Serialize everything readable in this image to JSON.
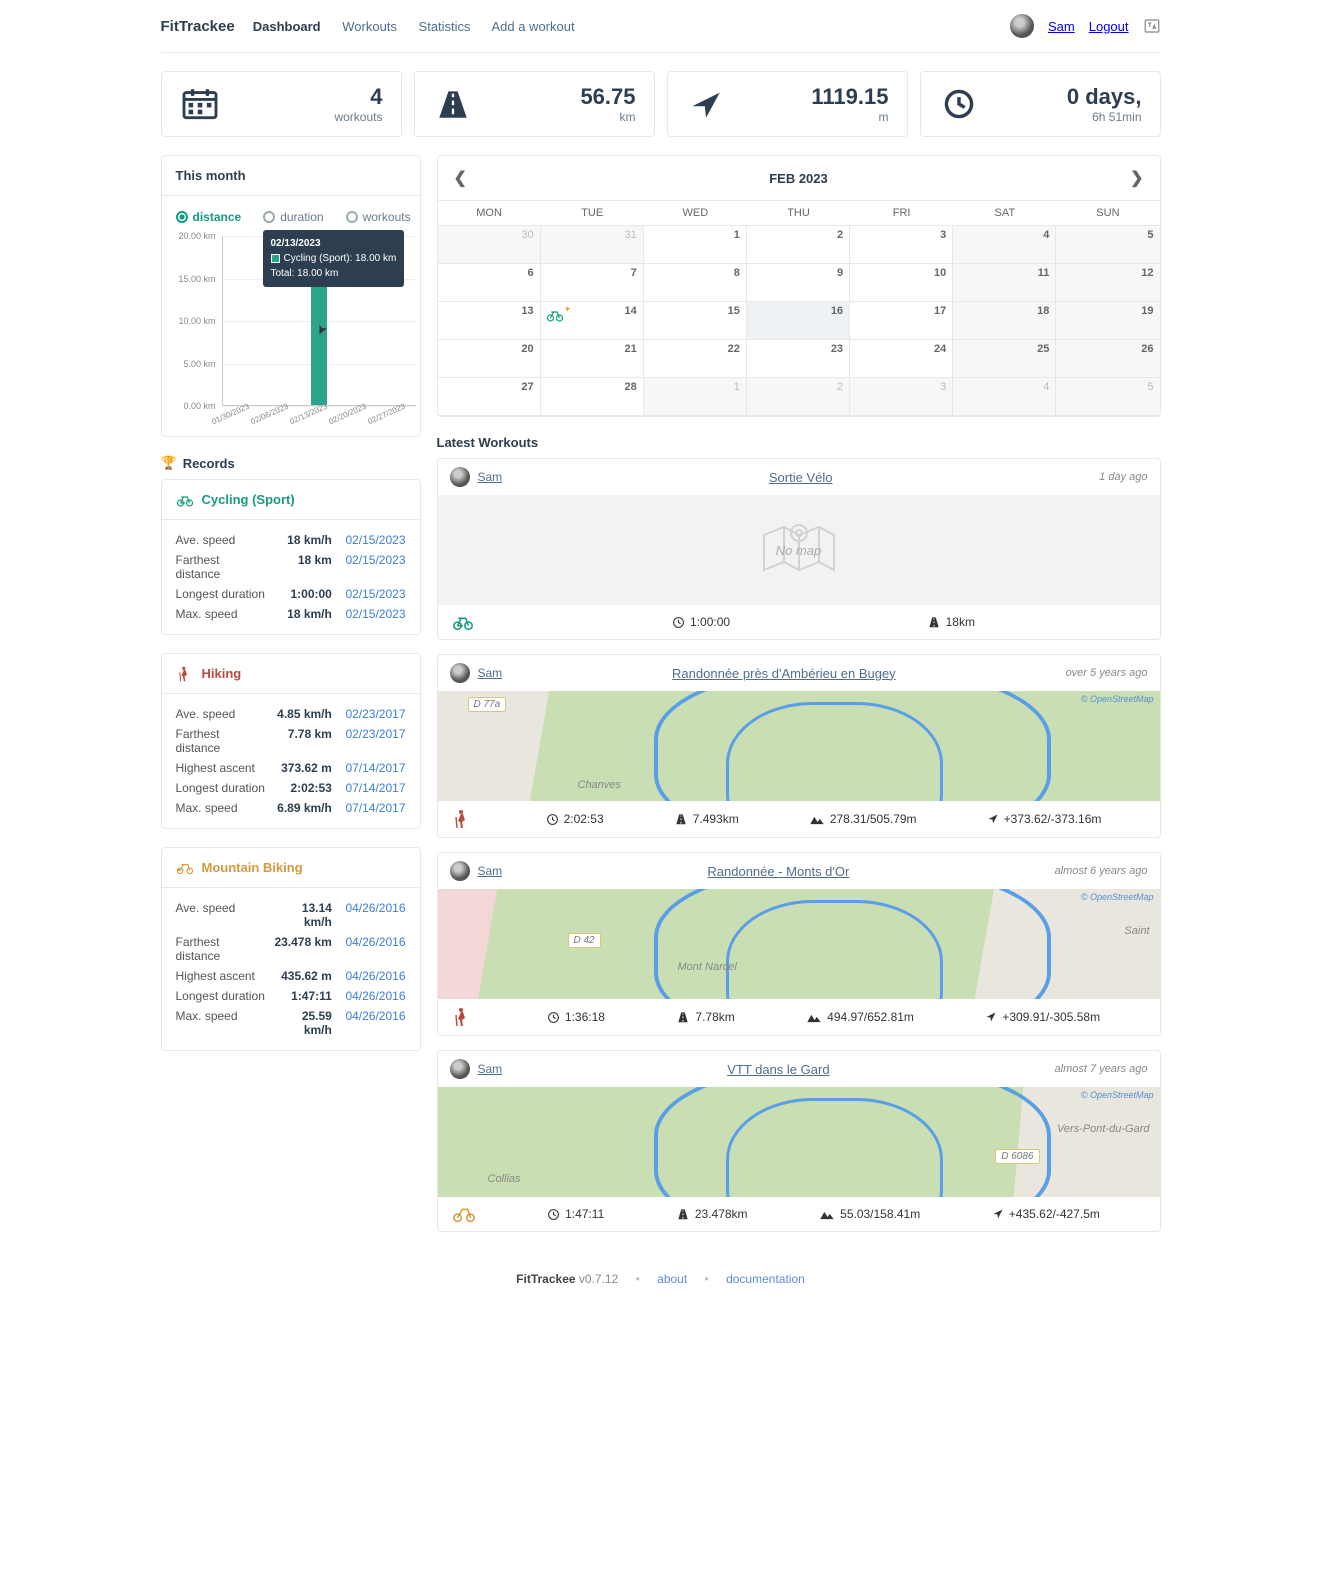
{
  "app_title": "FitTrackee",
  "nav": {
    "dashboard": "Dashboard",
    "workouts": "Workouts",
    "statistics": "Statistics",
    "add": "Add a workout"
  },
  "user": {
    "name": "Sam",
    "logout": "Logout"
  },
  "stats": {
    "workouts": {
      "value": "4",
      "label": "workouts"
    },
    "distance": {
      "value": "56.75",
      "label": "km"
    },
    "ascent": {
      "value": "1119.15",
      "label": "m"
    },
    "duration": {
      "value": "0 days,",
      "label": "6h 51min"
    }
  },
  "month_card": {
    "title": "This month",
    "radios": {
      "distance": "distance",
      "duration": "duration",
      "workouts": "workouts"
    },
    "tooltip": {
      "date": "02/13/2023",
      "series": "Cycling (Sport): 18.00 km",
      "total": "Total: 18.00 km"
    }
  },
  "chart_data": {
    "type": "bar",
    "categories": [
      "01/30/2023",
      "02/06/2023",
      "02/13/2023",
      "02/20/2023",
      "02/27/2023"
    ],
    "values": [
      0,
      0,
      18.0,
      0,
      0
    ],
    "ylabel": "km",
    "ylim": [
      0,
      20
    ],
    "yticks": [
      "0.00 km",
      "5.00 km",
      "10.00 km",
      "15.00 km",
      "20.00 km"
    ]
  },
  "records": {
    "title": "Records",
    "sports": [
      {
        "name": "Cycling (Sport)",
        "color": "#159b7f",
        "icon": "bike",
        "rows": [
          {
            "label": "Ave. speed",
            "value": "18 km/h",
            "date": "02/15/2023"
          },
          {
            "label": "Farthest distance",
            "value": "18 km",
            "date": "02/15/2023"
          },
          {
            "label": "Longest duration",
            "value": "1:00:00",
            "date": "02/15/2023"
          },
          {
            "label": "Max. speed",
            "value": "18 km/h",
            "date": "02/15/2023"
          }
        ]
      },
      {
        "name": "Hiking",
        "color": "#b94a3f",
        "icon": "hike",
        "rows": [
          {
            "label": "Ave. speed",
            "value": "4.85 km/h",
            "date": "02/23/2017"
          },
          {
            "label": "Farthest distance",
            "value": "7.78 km",
            "date": "02/23/2017"
          },
          {
            "label": "Highest ascent",
            "value": "373.62 m",
            "date": "07/14/2017"
          },
          {
            "label": "Longest duration",
            "value": "2:02:53",
            "date": "07/14/2017"
          },
          {
            "label": "Max. speed",
            "value": "6.89 km/h",
            "date": "07/14/2017"
          }
        ]
      },
      {
        "name": "Mountain Biking",
        "color": "#d89a3a",
        "icon": "mtb",
        "rows": [
          {
            "label": "Ave. speed",
            "value": "13.14 km/h",
            "date": "04/26/2016"
          },
          {
            "label": "Farthest distance",
            "value": "23.478 km",
            "date": "04/26/2016"
          },
          {
            "label": "Highest ascent",
            "value": "435.62 m",
            "date": "04/26/2016"
          },
          {
            "label": "Longest duration",
            "value": "1:47:11",
            "date": "04/26/2016"
          },
          {
            "label": "Max. speed",
            "value": "25.59 km/h",
            "date": "04/26/2016"
          }
        ]
      }
    ]
  },
  "calendar": {
    "title": "FEB 2023",
    "days": [
      "MON",
      "TUE",
      "WED",
      "THU",
      "FRI",
      "SAT",
      "SUN"
    ],
    "weeks": [
      [
        {
          "n": "30",
          "out": true
        },
        {
          "n": "31",
          "out": true
        },
        {
          "n": "1"
        },
        {
          "n": "2"
        },
        {
          "n": "3"
        },
        {
          "n": "4",
          "wknd": true
        },
        {
          "n": "5",
          "wknd": true
        }
      ],
      [
        {
          "n": "6"
        },
        {
          "n": "7"
        },
        {
          "n": "8"
        },
        {
          "n": "9"
        },
        {
          "n": "10"
        },
        {
          "n": "11",
          "wknd": true
        },
        {
          "n": "12",
          "wknd": true
        }
      ],
      [
        {
          "n": "13"
        },
        {
          "n": "14",
          "icon": "bike"
        },
        {
          "n": "15"
        },
        {
          "n": "16",
          "today": true
        },
        {
          "n": "17"
        },
        {
          "n": "18",
          "wknd": true
        },
        {
          "n": "19",
          "wknd": true
        }
      ],
      [
        {
          "n": "20"
        },
        {
          "n": "21"
        },
        {
          "n": "22"
        },
        {
          "n": "23"
        },
        {
          "n": "24"
        },
        {
          "n": "25",
          "wknd": true
        },
        {
          "n": "26",
          "wknd": true
        }
      ],
      [
        {
          "n": "27"
        },
        {
          "n": "28"
        },
        {
          "n": "1",
          "out": true
        },
        {
          "n": "2",
          "out": true
        },
        {
          "n": "3",
          "out": true
        },
        {
          "n": "4",
          "out": true,
          "wknd": true
        },
        {
          "n": "5",
          "out": true,
          "wknd": true
        }
      ]
    ]
  },
  "latest": {
    "title": "Latest Workouts",
    "items": [
      {
        "user": "Sam",
        "title": "Sortie Vélo",
        "when": "1 day ago",
        "sport": "bike",
        "sport_color": "#159b7f",
        "map": "none",
        "nomap_label": "No map",
        "stats": [
          {
            "icon": "clock",
            "text": "1:00:00"
          },
          {
            "icon": "road",
            "text": "18km"
          }
        ]
      },
      {
        "user": "Sam",
        "title": "Randonnée près d'Ambérieu en Bugey",
        "when": "over 5 years ago",
        "sport": "hike",
        "sport_color": "#b94a3f",
        "map": "green",
        "map_labels": {
          "road": "D 77a",
          "place": "Chanves",
          "attrib": "© OpenStreetMap"
        },
        "stats": [
          {
            "icon": "clock",
            "text": "2:02:53"
          },
          {
            "icon": "road",
            "text": "7.493km"
          },
          {
            "icon": "mtn",
            "text": "278.31/505.79m"
          },
          {
            "icon": "loc",
            "text": "+373.62/-373.16m"
          }
        ]
      },
      {
        "user": "Sam",
        "title": "Randonnée - Monts d'Or",
        "when": "almost 6 years ago",
        "sport": "hike",
        "sport_color": "#b94a3f",
        "map": "green2",
        "map_labels": {
          "road": "D 42",
          "place": "Mont Narcel",
          "place2": "Saint",
          "attrib": "© OpenStreetMap"
        },
        "stats": [
          {
            "icon": "clock",
            "text": "1:36:18"
          },
          {
            "icon": "road",
            "text": "7.78km"
          },
          {
            "icon": "mtn",
            "text": "494.97/652.81m"
          },
          {
            "icon": "loc",
            "text": "+309.91/-305.58m"
          }
        ]
      },
      {
        "user": "Sam",
        "title": "VTT dans le Gard",
        "when": "almost 7 years ago",
        "sport": "mtb",
        "sport_color": "#d89a3a",
        "map": "green3",
        "map_labels": {
          "road": "D 6086",
          "place": "Collias",
          "place2": "Vers-Pont-du-Gard",
          "attrib": "© OpenStreetMap"
        },
        "stats": [
          {
            "icon": "clock",
            "text": "1:47:11"
          },
          {
            "icon": "road",
            "text": "23.478km"
          },
          {
            "icon": "mtn",
            "text": "55.03/158.41m"
          },
          {
            "icon": "loc",
            "text": "+435.62/-427.5m"
          }
        ]
      }
    ]
  },
  "footer": {
    "brand": "FitTrackee",
    "version": "v0.7.12",
    "about": "about",
    "docs": "documentation"
  }
}
